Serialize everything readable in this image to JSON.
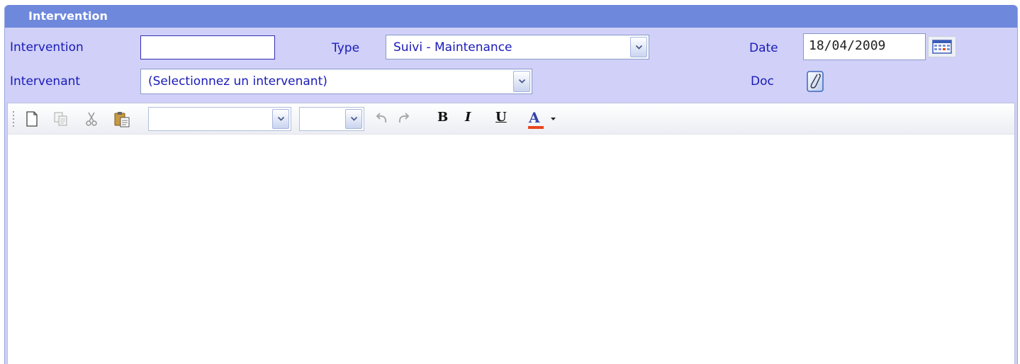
{
  "panel": {
    "title": "Intervention"
  },
  "form": {
    "intervention_label": "Intervention",
    "intervention_value": "",
    "type_label": "Type",
    "type_value": "Suivi - Maintenance",
    "date_label": "Date",
    "date_value": "18/04/2009",
    "intervenant_label": "Intervenant",
    "intervenant_value": "(Selectionnez un intervenant)",
    "doc_label": "Doc"
  },
  "toolbar": {
    "font_value": "",
    "size_value": "",
    "bold_label": "B",
    "italic_label": "I",
    "underline_label": "U",
    "fontcolor_label": "A",
    "fontcolor_color": "#e8451e"
  },
  "icons": [
    "calendar-icon",
    "doc-attach-icon",
    "new-document-icon",
    "copy-icon",
    "cut-icon",
    "paste-icon",
    "undo-icon",
    "redo-icon",
    "chevron-down-icon"
  ],
  "colors": {
    "title_bar": "#6e88dc",
    "panel_bg": "#d0d0f8",
    "label_text": "#1a1ab8"
  },
  "editor": {
    "content": ""
  }
}
